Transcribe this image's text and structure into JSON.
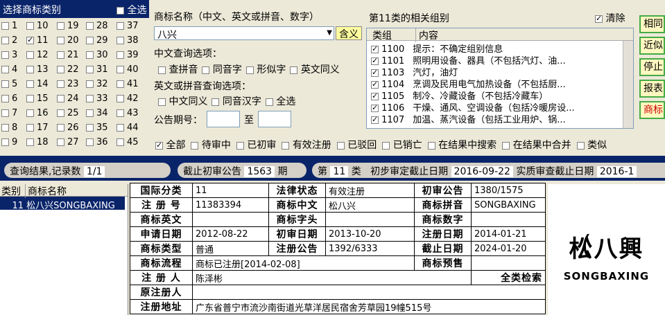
{
  "class_panel": {
    "title": "选择商标类别",
    "select_all": "全选",
    "checked": [
      "11"
    ],
    "columns": [
      [
        "1",
        "2",
        "3",
        "4",
        "5",
        "6",
        "7",
        "8",
        "9"
      ],
      [
        "10",
        "11",
        "12",
        "13",
        "14",
        "15",
        "16",
        "17",
        "18"
      ],
      [
        "19",
        "20",
        "21",
        "22",
        "23",
        "24",
        "25",
        "26",
        "27"
      ],
      [
        "28",
        "29",
        "30",
        "31",
        "32",
        "33",
        "34",
        "35",
        "36"
      ],
      [
        "37",
        "38",
        "39",
        "40",
        "41",
        "42",
        "43",
        "44",
        "45"
      ]
    ]
  },
  "query": {
    "name_label": "商标名称（中文、英文或拼音、数字）",
    "name_value": "八兴",
    "meaning_button": "含义",
    "cn_options_label": "中文查询选项：",
    "cn_options": [
      "查拼音",
      "同音字",
      "形似字",
      "英文同义"
    ],
    "en_options_label": "英文或拼音查询选项：",
    "en_options": [
      "中文同义",
      "同音汉字",
      "全选"
    ],
    "gazette_label": "公告期号：",
    "to_label": "至"
  },
  "groups": {
    "title": "第11类的相关组别",
    "clear_label": "清除",
    "col_group": "类组",
    "col_content": "内容",
    "rows": [
      {
        "code": "1100",
        "text": "提示：不确定组别信息"
      },
      {
        "code": "1101",
        "text": "照明用设备、器具（不包括汽灯、油..."
      },
      {
        "code": "1103",
        "text": "汽灯，油灯"
      },
      {
        "code": "1104",
        "text": "烹调及民用电气加热设备（不包括厨..."
      },
      {
        "code": "1105",
        "text": "制冷、冷藏设备（不包括冷藏车）"
      },
      {
        "code": "1106",
        "text": "干燥、通风、空调设备（包括冷暖房设..."
      },
      {
        "code": "1107",
        "text": "加温、蒸汽设备（包括工业用炉、锅..."
      }
    ]
  },
  "right_buttons": [
    "相同",
    "近似",
    "停止",
    "报表",
    "商标"
  ],
  "filters": [
    "全部",
    "待审中",
    "已初审",
    "有效注册",
    "已驳回",
    "已销亡",
    "在结果中搜索",
    "在结果中合并",
    "类似"
  ],
  "result_bar": {
    "count_label": "查询结果,记录数",
    "count_value": "1/1",
    "deadline_label": "截止初审公告",
    "deadline_value": "1563",
    "deadline_unit": "期",
    "class_prefix": "第",
    "class_value": "11",
    "class_suffix": "类",
    "prelim_label": "初步审定截止日期",
    "prelim_value": "2016-09-22",
    "subst_label": "实质审查截止日期",
    "subst_value": "2016-1"
  },
  "list": {
    "col_class": "类别",
    "col_name": "商标名称",
    "rows": [
      {
        "class": "11",
        "name": "松八兴SONGBAXING"
      }
    ]
  },
  "detail": {
    "intl_class_k": "国际分类",
    "intl_class_v": "11",
    "legal_k": "法律状态",
    "legal_v": "有效注册",
    "prelim_k": "初审公告",
    "prelim_v": "1380/1575",
    "regno_k": "注 册 号",
    "regno_v": "11383394",
    "cn_k": "商标中文",
    "cn_v": "松八兴",
    "py_k": "商标拼音",
    "py_v": "SONGBAXING",
    "en_k": "商标英文",
    "en_v": "",
    "head_k": "商标字头",
    "head_v": "",
    "num_k": "商标数字",
    "num_v": "",
    "apply_k": "申请日期",
    "apply_v": "2012-08-22",
    "pdate_k": "初审日期",
    "pdate_v": "2013-10-20",
    "rdate_k": "注册日期",
    "rdate_v": "2014-01-21",
    "type_k": "商标类型",
    "type_v": "普通",
    "rnote_k": "注册公告",
    "rnote_v": "1392/6333",
    "end_k": "截止日期",
    "end_v": "2024-01-20",
    "flow_k": "商标流程",
    "flow_v": "商标已注册[2014-02-08]",
    "pre_k": "商标预售",
    "pre_v": "",
    "reg_k": "注 册 人",
    "reg_v": "陈泽彬",
    "search_all": "全类检索",
    "orig_k": "原注册人",
    "orig_v": "",
    "addr_k": "注册地址",
    "addr_v": "广东省普宁市流沙南街道光草洋居民宿舍芳草园19幢515号"
  },
  "logo": {
    "chars": "松八興",
    "text": "SONGBAXING"
  }
}
